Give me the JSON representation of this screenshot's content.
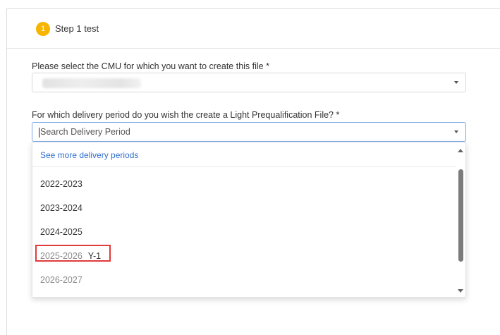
{
  "step": {
    "number": "1",
    "title": "Step 1 test"
  },
  "cmu_field": {
    "label": "Please select the CMU for which you want to create this file *"
  },
  "delivery_field": {
    "label": "For which delivery period do you wish the create a Light Prequalification File? *",
    "placeholder": "Search Delivery Period"
  },
  "dropdown": {
    "see_more": "See more delivery periods",
    "items": [
      {
        "label": "2022-2023",
        "tag": ""
      },
      {
        "label": "2023-2024",
        "tag": ""
      },
      {
        "label": "2024-2025",
        "tag": ""
      },
      {
        "label": "2025-2026",
        "tag": "Y-1"
      },
      {
        "label": "2026-2027",
        "tag": ""
      }
    ]
  },
  "colors": {
    "step_badge": "#f7b500",
    "link": "#2f6fcf",
    "highlight_box": "#e03a3a",
    "active_border": "#7aa7e8"
  }
}
